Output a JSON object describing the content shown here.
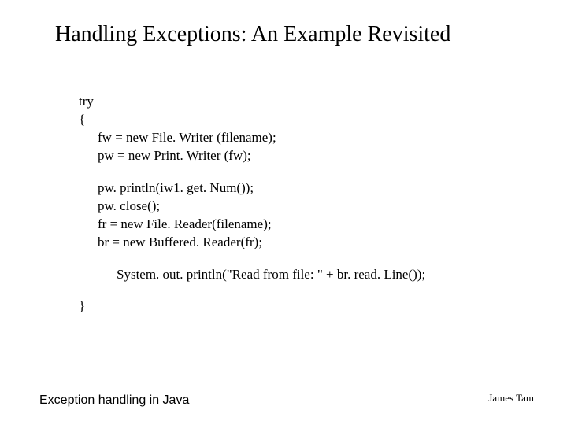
{
  "title": "Handling Exceptions: An Example Revisited",
  "code": {
    "l0": "try",
    "l1": "{",
    "l2": "fw = new File. Writer (filename);",
    "l3": "pw = new Print. Writer (fw);",
    "l4": "pw. println(iw1. get. Num());",
    "l5": "pw. close();",
    "l6": "fr = new File. Reader(filename);",
    "l7": "br = new Buffered. Reader(fr);",
    "l8": "System. out. println(\"Read from file: \" + br. read. Line());",
    "l9": "}"
  },
  "footer": {
    "left": "Exception handling in Java",
    "right": "James Tam"
  }
}
